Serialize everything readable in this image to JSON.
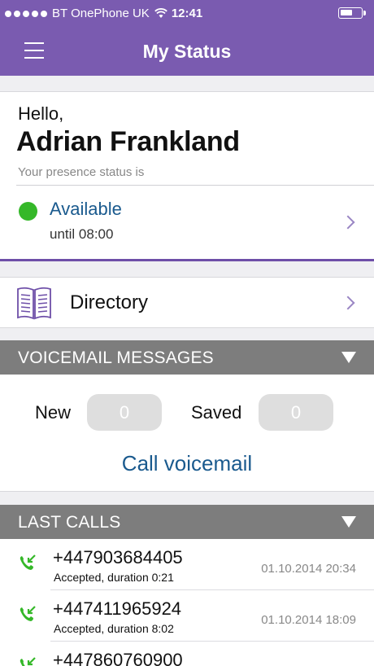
{
  "statusbar": {
    "carrier": "BT OnePhone UK",
    "time": "12:41",
    "battery_level": 0.6
  },
  "navbar": {
    "title": "My Status"
  },
  "profile": {
    "greeting": "Hello,",
    "name": "Adrian Frankland",
    "presence_label": "Your presence status is",
    "status": "Available",
    "until": "until 08:00",
    "status_color": "#35b829"
  },
  "directory": {
    "label": "Directory"
  },
  "voicemail": {
    "header": "VOICEMAIL MESSAGES",
    "new_label": "New",
    "new_count": "0",
    "saved_label": "Saved",
    "saved_count": "0",
    "call_label": "Call voicemail"
  },
  "last_calls": {
    "header": "LAST CALLS",
    "items": [
      {
        "number": "+447903684405",
        "detail": "Accepted, duration 0:21",
        "time": "01.10.2014 20:34"
      },
      {
        "number": "+447411965924",
        "detail": "Accepted, duration 8:02",
        "time": "01.10.2014 18:09"
      },
      {
        "number": "+447860760900",
        "detail": "",
        "time": ""
      }
    ]
  },
  "colors": {
    "brand": "#7a5bb0",
    "link": "#1a5a8e",
    "section_header": "#7d7d7d",
    "accepted_call": "#35b829"
  }
}
